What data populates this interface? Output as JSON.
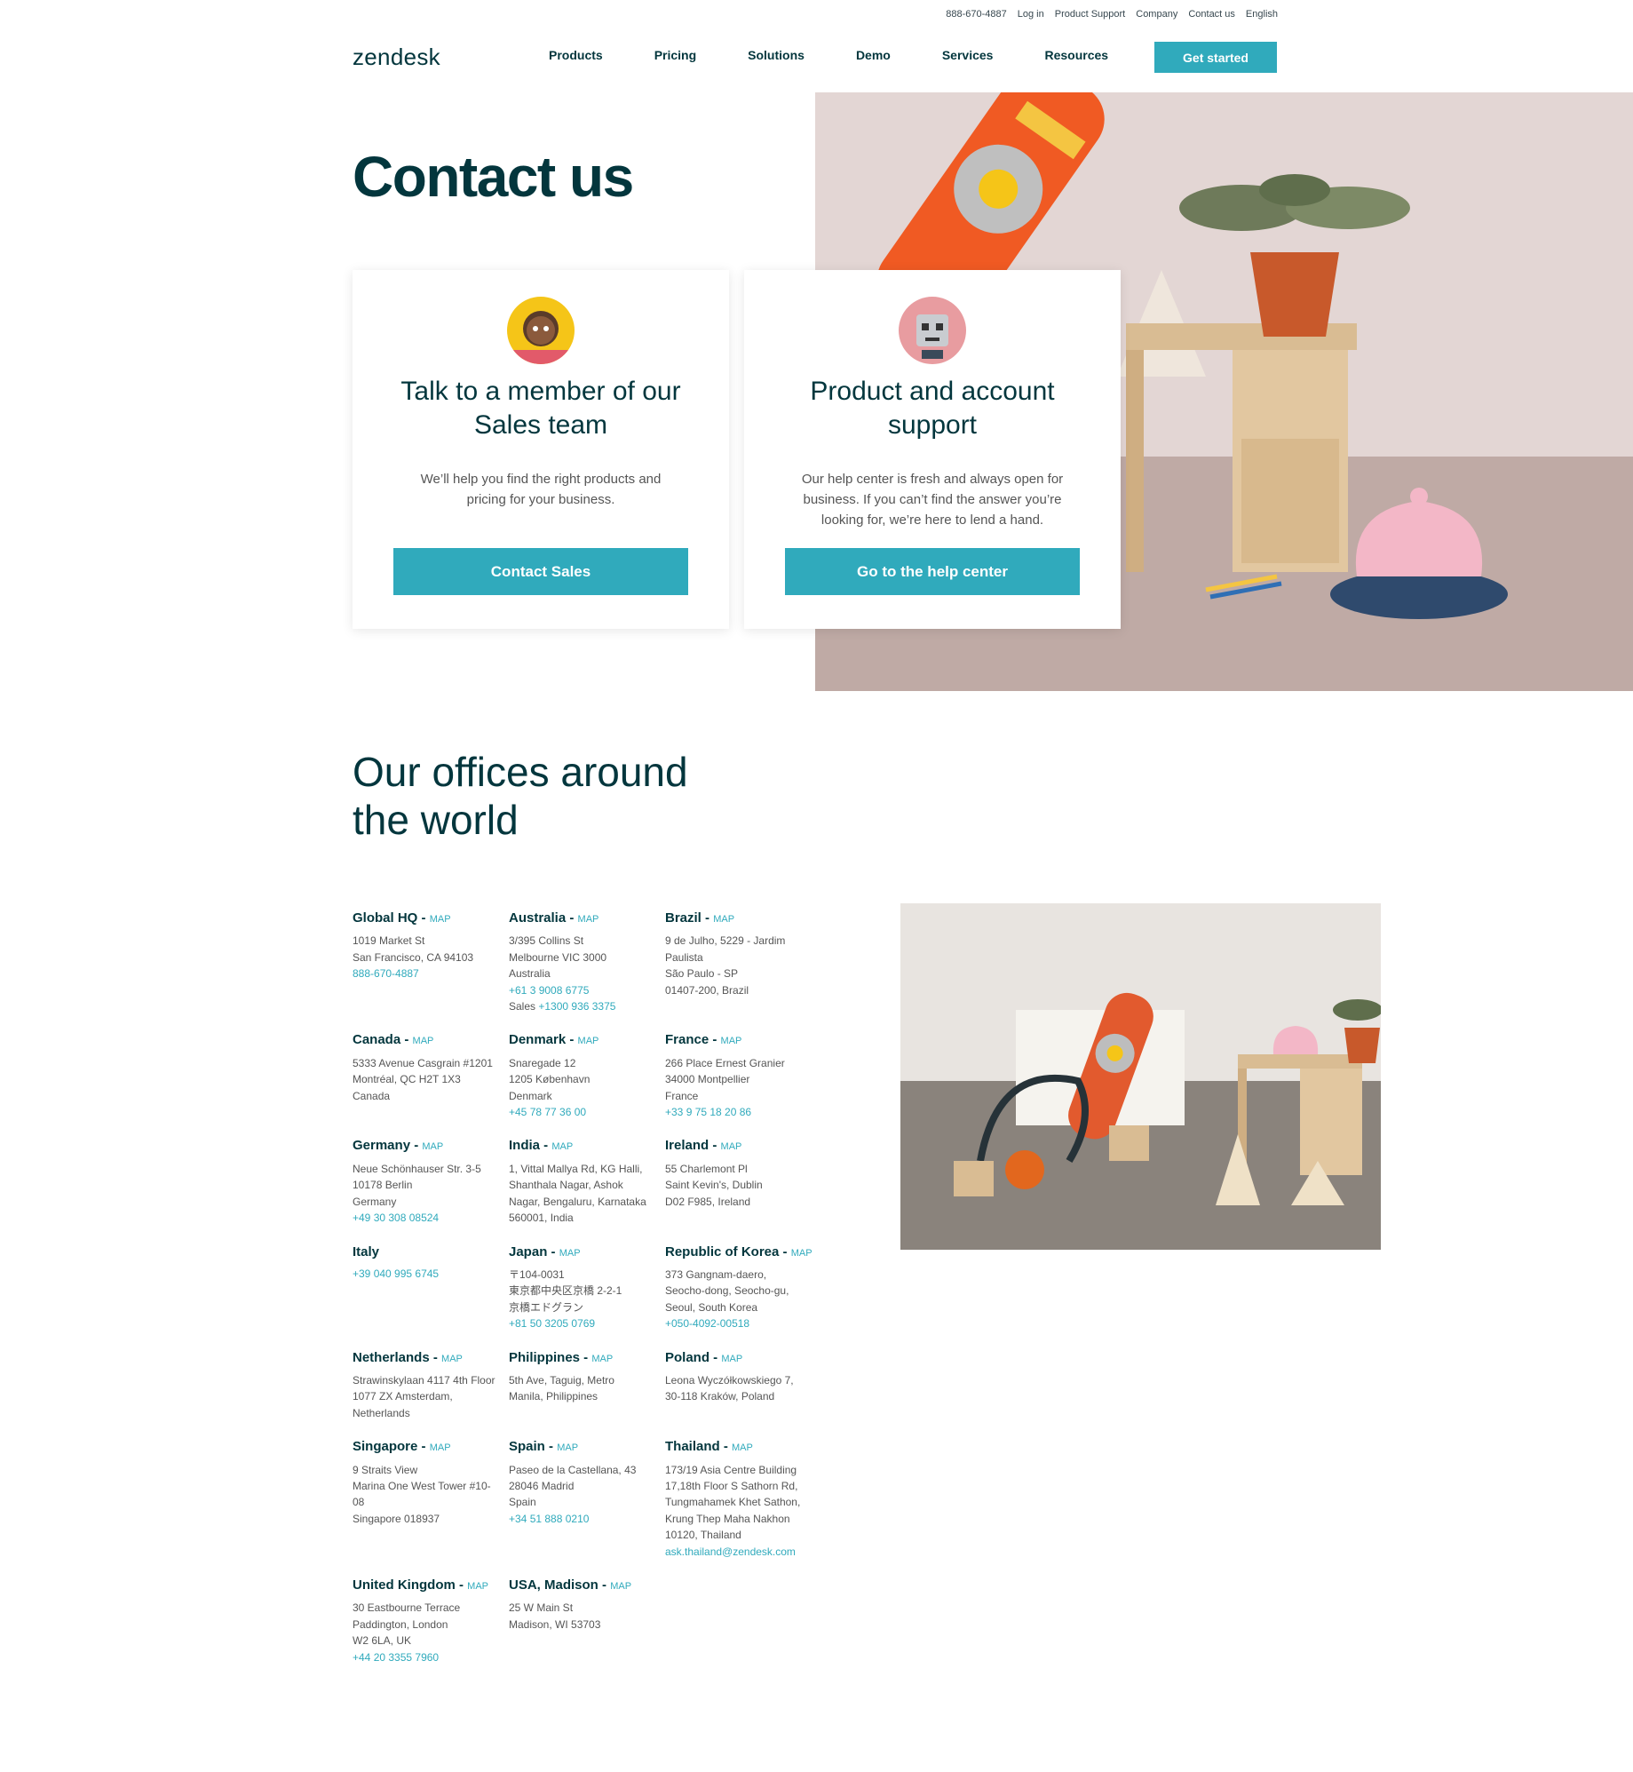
{
  "utility_nav": [
    "888-670-4887",
    "Log in",
    "Product Support",
    "Company",
    "Contact us",
    "English"
  ],
  "brand": {
    "logo_text": "zendesk"
  },
  "nav": {
    "items": [
      "Products",
      "Pricing",
      "Solutions",
      "Demo",
      "Services",
      "Resources"
    ],
    "cta": "Get started"
  },
  "hero": {
    "title": "Contact us"
  },
  "cards": {
    "sales": {
      "title": "Talk to a member of our Sales team",
      "desc": "We’ll help you find the right products and pricing for your business.",
      "button": "Contact Sales"
    },
    "support": {
      "title": "Product and account support",
      "desc": "Our help center is fresh and always open for business. If you can’t find the answer you’re looking for, we’re here to lend a hand.",
      "button": "Go to the help center"
    }
  },
  "offices_section": {
    "title": "Our offices around the world"
  },
  "offices": [
    {
      "name": "Global HQ",
      "map": "MAP",
      "lines": [
        "1019 Market St",
        "San Francisco, CA 94103"
      ],
      "links": [
        "888-670-4887"
      ]
    },
    {
      "name": "Australia",
      "map": "MAP",
      "lines": [
        "3/395 Collins St",
        "Melbourne VIC 3000",
        "Australia"
      ],
      "links": [
        "+61 3 9008 6775"
      ],
      "extra_label": "Sales ",
      "extra_link": "+1300 936 3375"
    },
    {
      "name": "Brazil",
      "map": "MAP",
      "lines": [
        "9 de Julho, 5229 - Jardim",
        "Paulista",
        "São Paulo - SP",
        "01407-200, Brazil"
      ],
      "links": []
    },
    {
      "name": "Canada",
      "map": "MAP",
      "lines": [
        "5333 Avenue Casgrain #1201",
        "Montréal, QC H2T 1X3",
        "Canada"
      ],
      "links": []
    },
    {
      "name": "Denmark",
      "map": "MAP",
      "lines": [
        "Snaregade 12",
        "1205 København",
        "Denmark"
      ],
      "links": [
        "+45 78 77 36 00"
      ]
    },
    {
      "name": "France",
      "map": "MAP",
      "lines": [
        "266 Place Ernest Granier",
        "34000 Montpellier",
        "France"
      ],
      "links": [
        "+33 9 75 18 20 86"
      ]
    },
    {
      "name": "Germany",
      "map": "MAP",
      "lines": [
        "Neue Schönhauser Str. 3-5",
        "10178 Berlin",
        "Germany"
      ],
      "links": [
        "+49 30 308 08524"
      ]
    },
    {
      "name": "India",
      "map": "MAP",
      "lines": [
        "1, Vittal Mallya Rd, KG Halli,",
        "Shanthala Nagar, Ashok",
        "Nagar, Bengaluru, Karnataka",
        "560001, India"
      ],
      "links": []
    },
    {
      "name": "Ireland",
      "map": "MAP",
      "lines": [
        "55 Charlemont Pl",
        "Saint Kevin's, Dublin",
        "D02 F985, Ireland"
      ],
      "links": []
    },
    {
      "name": "Italy",
      "map": "",
      "lines": [],
      "links": [
        "+39 040 995 6745"
      ]
    },
    {
      "name": "Japan",
      "map": "MAP",
      "lines": [
        "〒104-0031",
        "東京都中央区京橋 2-2-1",
        "京橋エドグラン"
      ],
      "links": [
        "+81 50 3205 0769"
      ]
    },
    {
      "name": "Republic of Korea",
      "map": "MAP",
      "lines": [
        "373 Gangnam-daero,",
        "Seocho-dong, Seocho-gu,",
        "Seoul, South Korea"
      ],
      "links": [
        "+050-4092-00518"
      ]
    },
    {
      "name": "Netherlands",
      "map": "MAP",
      "lines": [
        "Strawinskylaan 4117 4th Floor",
        "1077 ZX Amsterdam,",
        "Netherlands"
      ],
      "links": []
    },
    {
      "name": "Philippines",
      "map": "MAP",
      "lines": [
        "5th Ave, Taguig, Metro",
        "Manila, Philippines"
      ],
      "links": []
    },
    {
      "name": "Poland",
      "map": "MAP",
      "lines": [
        "Leona Wyczółkowskiego 7,",
        "30-118 Kraków, Poland"
      ],
      "links": []
    },
    {
      "name": "Singapore",
      "map": "MAP",
      "lines": [
        "9 Straits View",
        "Marina One West Tower #10-",
        "08",
        "Singapore 018937"
      ],
      "links": []
    },
    {
      "name": "Spain",
      "map": "MAP",
      "lines": [
        "Paseo de la Castellana, 43",
        "28046 Madrid",
        "Spain"
      ],
      "links": [
        "+34 51 888 0210"
      ]
    },
    {
      "name": "Thailand",
      "map": "MAP",
      "lines": [
        "173/19 Asia Centre Building",
        "17,18th Floor S Sathorn Rd,",
        "Tungmahamek Khet Sathon,",
        "Krung Thep Maha Nakhon",
        "10120, Thailand"
      ],
      "links": [
        "ask.thailand@zendesk.com"
      ]
    },
    {
      "name": "United Kingdom",
      "map": "MAP",
      "lines": [
        "30 Eastbourne Terrace",
        "Paddington, London",
        "W2 6LA, UK"
      ],
      "links": [
        "+44 20 3355 7960"
      ]
    },
    {
      "name": "USA, Madison",
      "map": "MAP",
      "lines": [
        "25 W Main St",
        "Madison, WI 53703"
      ],
      "links": []
    }
  ],
  "colors": {
    "brand_teal": "#30aabc",
    "dark_text": "#03363d",
    "body_text": "#555555"
  }
}
